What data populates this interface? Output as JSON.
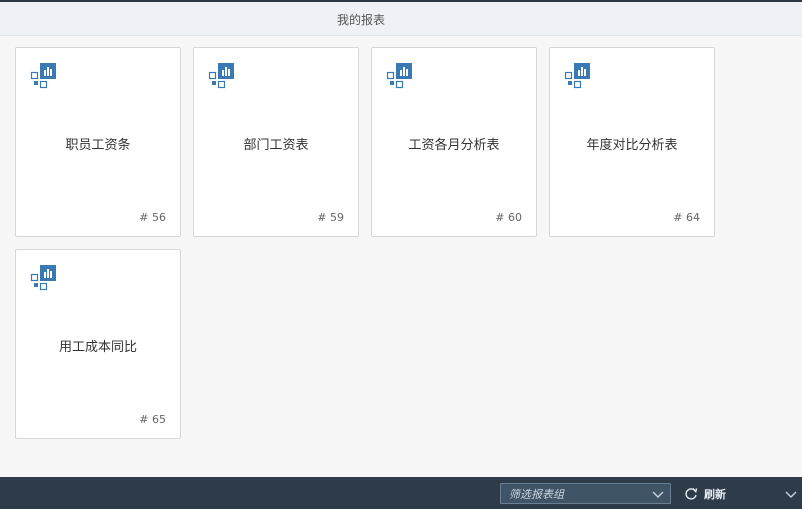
{
  "header": {
    "title": "我的报表"
  },
  "reports": [
    {
      "name": "职员工资条",
      "number": "# 56"
    },
    {
      "name": "部门工资表",
      "number": "# 59"
    },
    {
      "name": "工资各月分析表",
      "number": "# 60"
    },
    {
      "name": "年度对比分析表",
      "number": "# 64"
    },
    {
      "name": "用工成本同比",
      "number": "# 65"
    }
  ],
  "icons": {
    "report": "report-chart-icon",
    "chevron": "chevron-down-icon",
    "refresh": "refresh-icon"
  },
  "footer": {
    "filter_placeholder": "筛选报表组",
    "refresh_label": "刷新"
  },
  "colors": {
    "accent": "#3a7ab4",
    "footer": "#2e3b48"
  }
}
